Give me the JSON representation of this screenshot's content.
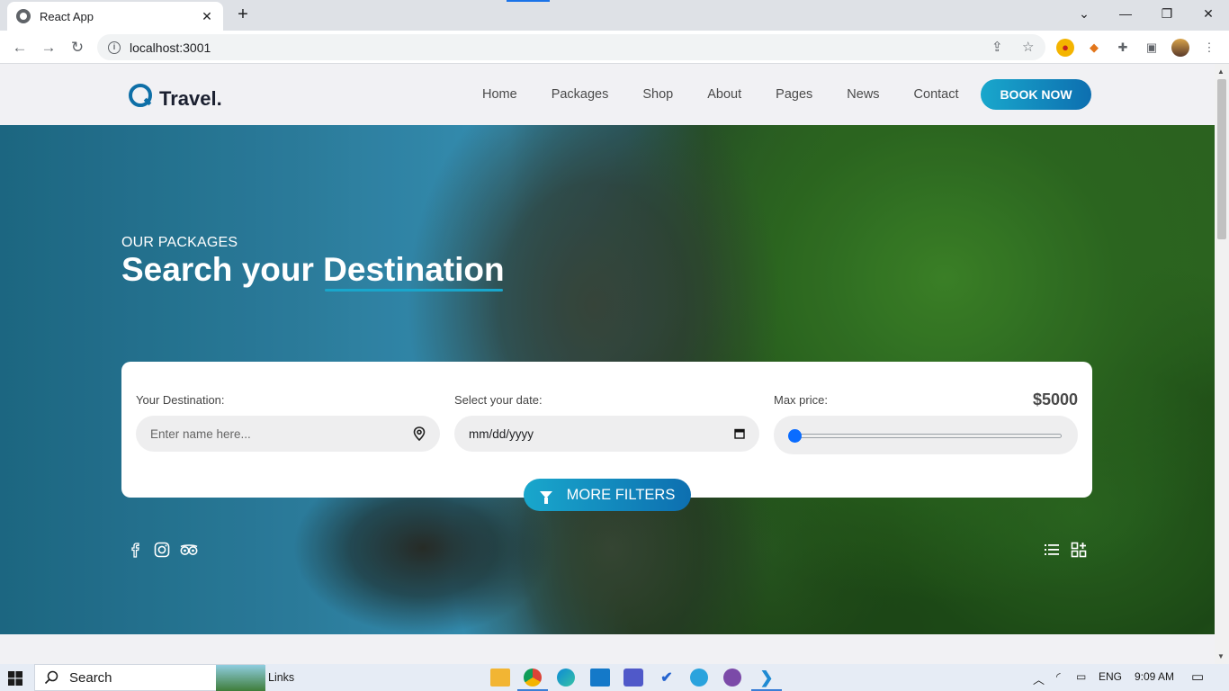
{
  "browser": {
    "tab_title": "React App",
    "url": "localhost:3001",
    "new_tab": "+",
    "close_tab": "✕"
  },
  "site": {
    "logo_text": "Travel.",
    "nav": [
      "Home",
      "Packages",
      "Shop",
      "About",
      "Pages",
      "News",
      "Contact"
    ],
    "book_now": "BOOK NOW"
  },
  "hero": {
    "subtitle": "OUR PACKAGES",
    "title_part1": "Search your ",
    "title_highlight": "Destination"
  },
  "search_card": {
    "destination_label": "Your Destination:",
    "destination_placeholder": "Enter name here...",
    "date_label": "Select your date:",
    "date_value": "mm/dd/yyyy",
    "price_label": "Max price:",
    "price_value": "$5000",
    "more_filters": "MORE FILTERS",
    "slider_fraction": 0.0
  },
  "taskbar": {
    "search_label": "Search",
    "links_label": "Links",
    "language": "ENG",
    "time": "9:09 AM"
  },
  "colors": {
    "accent_start": "#19a7cc",
    "accent_end": "#0d6fb0",
    "slider_knob": "#0a6cff"
  }
}
